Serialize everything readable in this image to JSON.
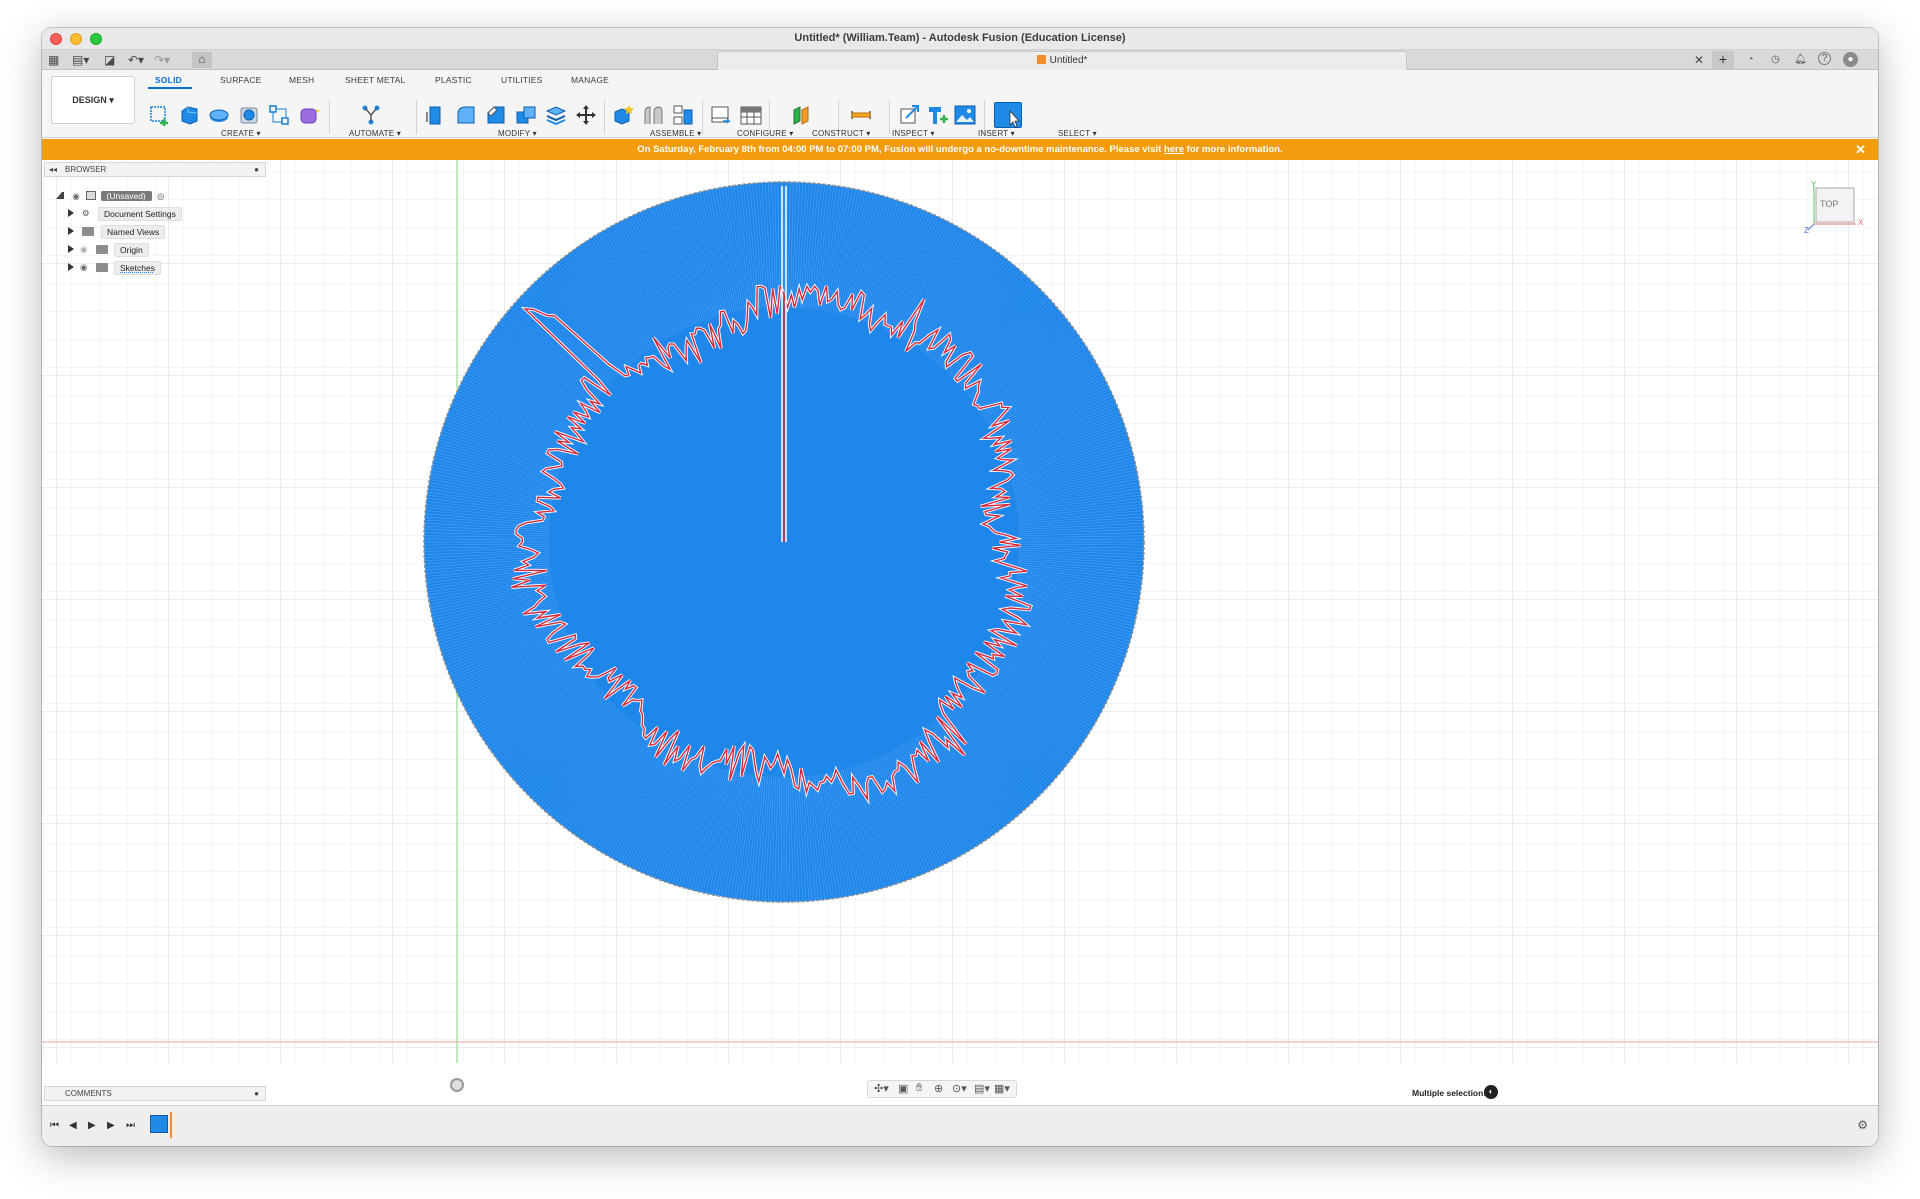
{
  "window": {
    "title": "Untitled* (William.Team) - Autodesk Fusion (Education License)"
  },
  "tab": {
    "label": "Untitled*"
  },
  "toolbar": {
    "design_label": "DESIGN",
    "workspace_tabs": [
      {
        "label": "SOLID",
        "active": true
      },
      {
        "label": "SURFACE",
        "active": false
      },
      {
        "label": "MESH",
        "active": false
      },
      {
        "label": "SHEET METAL",
        "active": false
      },
      {
        "label": "PLASTIC",
        "active": false
      },
      {
        "label": "UTILITIES",
        "active": false
      },
      {
        "label": "MANAGE",
        "active": false
      }
    ],
    "groups": {
      "create": "CREATE",
      "automate": "AUTOMATE",
      "modify": "MODIFY",
      "assemble": "ASSEMBLE",
      "configure": "CONFIGURE",
      "construct": "CONSTRUCT",
      "inspect": "INSPECT",
      "insert": "INSERT",
      "select": "SELECT"
    }
  },
  "notice": {
    "text_before": "On Saturday, February 8th from 04:00 PM to 07:00 PM, Fusion will undergo a no-downtime maintenance. Please visit ",
    "link": "here",
    "text_after": " for more information."
  },
  "browser": {
    "title": "BROWSER",
    "root": "(Unsaved)",
    "items": [
      {
        "label": "Document Settings",
        "icon": "gear-icon"
      },
      {
        "label": "Named Views",
        "icon": "folder-icon"
      },
      {
        "label": "Origin",
        "icon": "folder-icon"
      },
      {
        "label": "Sketches",
        "icon": "folder-icon"
      }
    ]
  },
  "comments": {
    "title": "COMMENTS"
  },
  "viewcube": {
    "face": "TOP",
    "axis_x": "X",
    "axis_y": "Y",
    "axis_z": "Z"
  },
  "status": {
    "selection": "Multiple selections"
  },
  "colors": {
    "accent": "#0a6fd1",
    "notice": "#f29c0e",
    "sketch_fill": "#1f86ea",
    "sketch_line": "#d4293b"
  }
}
